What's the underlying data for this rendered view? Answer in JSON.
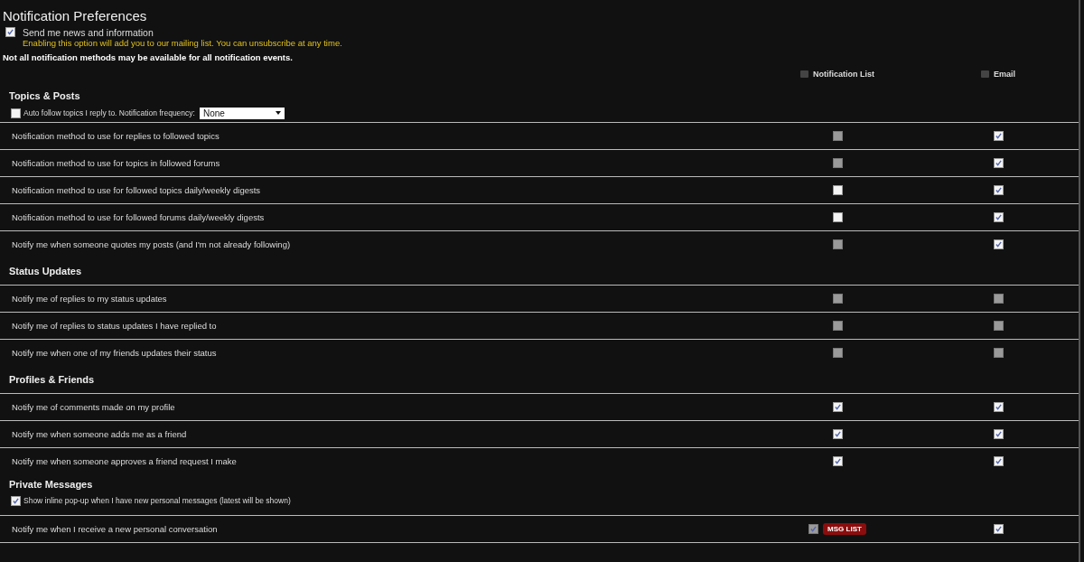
{
  "title": "Notification Preferences",
  "newsletter": {
    "label": "Send me news and information",
    "hint": "Enabling this option will add you to our mailing list. You can unsubscribe at any time.",
    "checked": true
  },
  "note": "Not all notification methods may be available for all notification events.",
  "columns": [
    {
      "label": "Notification List"
    },
    {
      "label": "Email"
    }
  ],
  "sections": [
    {
      "title": "Topics & Posts",
      "option": {
        "label": "Auto follow topics I reply to. Notification frequency:",
        "checked": false,
        "select": "None"
      },
      "rows": [
        {
          "label": "Notification method to use for replies to followed topics",
          "list": {
            "checked": false,
            "disabled": true
          },
          "email": {
            "checked": true,
            "disabled": false
          }
        },
        {
          "label": "Notification method to use for topics in followed forums",
          "list": {
            "checked": false,
            "disabled": true
          },
          "email": {
            "checked": true,
            "disabled": false
          }
        },
        {
          "label": "Notification method to use for followed topics daily/weekly digests",
          "list": {
            "checked": false,
            "disabled": false
          },
          "email": {
            "checked": true,
            "disabled": false
          }
        },
        {
          "label": "Notification method to use for followed forums daily/weekly digests",
          "list": {
            "checked": false,
            "disabled": false
          },
          "email": {
            "checked": true,
            "disabled": false
          }
        },
        {
          "label": "Notify me when someone quotes my posts (and I'm not already following)",
          "list": {
            "checked": false,
            "disabled": true
          },
          "email": {
            "checked": true,
            "disabled": false
          }
        }
      ]
    },
    {
      "title": "Status Updates",
      "rows": [
        {
          "label": "Notify me of replies to my status updates",
          "list": {
            "checked": false,
            "disabled": true
          },
          "email": {
            "checked": false,
            "disabled": true
          }
        },
        {
          "label": "Notify me of replies to status updates I have replied to",
          "list": {
            "checked": false,
            "disabled": true
          },
          "email": {
            "checked": false,
            "disabled": true
          }
        },
        {
          "label": "Notify me when one of my friends updates their status",
          "list": {
            "checked": false,
            "disabled": true
          },
          "email": {
            "checked": false,
            "disabled": true
          }
        }
      ]
    },
    {
      "title": "Profiles & Friends",
      "rows": [
        {
          "label": "Notify me of comments made on my profile",
          "list": {
            "checked": true,
            "disabled": false
          },
          "email": {
            "checked": true,
            "disabled": false
          }
        },
        {
          "label": "Notify me when someone adds me as a friend",
          "list": {
            "checked": true,
            "disabled": false
          },
          "email": {
            "checked": true,
            "disabled": false
          }
        },
        {
          "label": "Notify me when someone approves a friend request I make",
          "list": {
            "checked": true,
            "disabled": false
          },
          "email": {
            "checked": true,
            "disabled": false
          }
        }
      ]
    },
    {
      "title": "Private Messages",
      "option": {
        "label": "Show inline pop-up when I have new personal messages (latest will be shown)",
        "checked": true
      },
      "rows": [
        {
          "label": "Notify me when I receive a new personal conversation",
          "list": {
            "checked": true,
            "disabled": true,
            "badge": "MSG LIST"
          },
          "email": {
            "checked": true,
            "disabled": false
          }
        }
      ]
    }
  ]
}
